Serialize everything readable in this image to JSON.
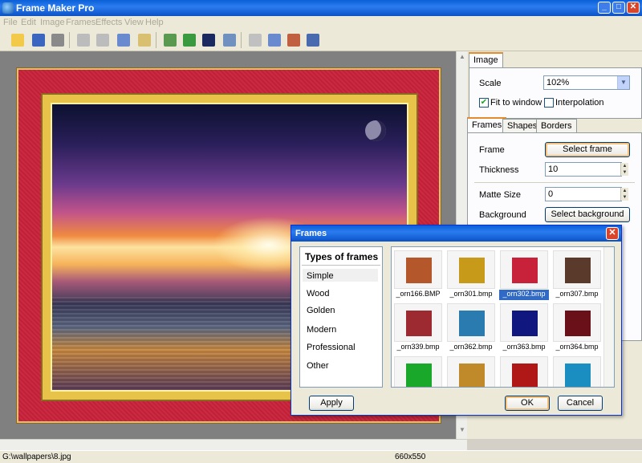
{
  "window": {
    "title": "Frame Maker Pro",
    "min": "_",
    "max": "□",
    "close": "✕"
  },
  "menu": [
    "File",
    "Edit",
    "Image",
    "Frames",
    "Effects",
    "View",
    "Help"
  ],
  "panel": {
    "image_tab": "Image",
    "scale_label": "Scale",
    "scale_value": "102%",
    "fit_label": "Fit to window",
    "fit_checked": true,
    "interp_label": "Interpolation",
    "interp_checked": false,
    "tabs": [
      "Frames",
      "Shapes",
      "Borders"
    ],
    "frame_label": "Frame",
    "select_frame": "Select frame",
    "thickness_label": "Thickness",
    "thickness_value": "10",
    "matte_label": "Matte Size",
    "matte_value": "0",
    "background_label": "Background",
    "select_background": "Select background"
  },
  "status": {
    "path": "G:\\wallpapers\\8.jpg",
    "size": "660x550"
  },
  "dialog": {
    "title": "Frames",
    "types_header": "Types of frames",
    "types": [
      "Simple",
      "Wood",
      "Golden",
      "Modern",
      "Professional",
      "Other"
    ],
    "selected_type": "Simple",
    "frames": [
      {
        "name": "_orn166.BMP",
        "color": "#b4572a"
      },
      {
        "name": "_orn301.bmp",
        "color": "#c79a1a"
      },
      {
        "name": "_orn302.bmp",
        "color": "#c8223a",
        "selected": true
      },
      {
        "name": "_orn307.bmp",
        "color": "#5a3a2a"
      },
      {
        "name": "_orn339.bmp",
        "color": "#9c2a30"
      },
      {
        "name": "_orn362.bmp",
        "color": "#2a7cb0"
      },
      {
        "name": "_orn363.bmp",
        "color": "#101880"
      },
      {
        "name": "_orn364.bmp",
        "color": "#6a1018"
      },
      {
        "name": "",
        "color": "#1aa82a"
      },
      {
        "name": "",
        "color": "#c08a2a"
      },
      {
        "name": "",
        "color": "#b01818"
      },
      {
        "name": "",
        "color": "#1a8ec0"
      }
    ],
    "apply": "Apply",
    "ok": "OK",
    "cancel": "Cancel"
  }
}
